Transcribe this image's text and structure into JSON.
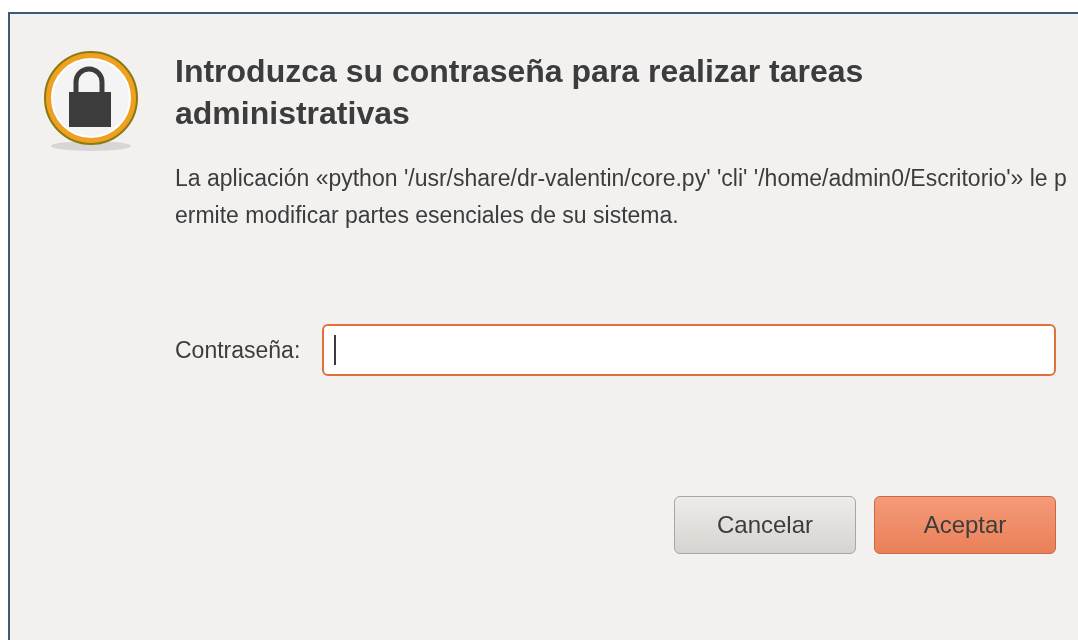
{
  "dialog": {
    "title": "Introduzca su contraseña para realizar tareas administrativas",
    "message": "La aplicación «python '/usr/share/dr-valentin/core.py' 'cli' '/home/admin0/Escritorio'» le permite modificar partes esenciales de su sistema.",
    "password_label": "Contraseña:",
    "password_field": {
      "focused": true
    },
    "buttons": [
      {
        "label": "Cancelar",
        "default": false
      },
      {
        "label": "Aceptar",
        "default": true
      }
    ]
  }
}
